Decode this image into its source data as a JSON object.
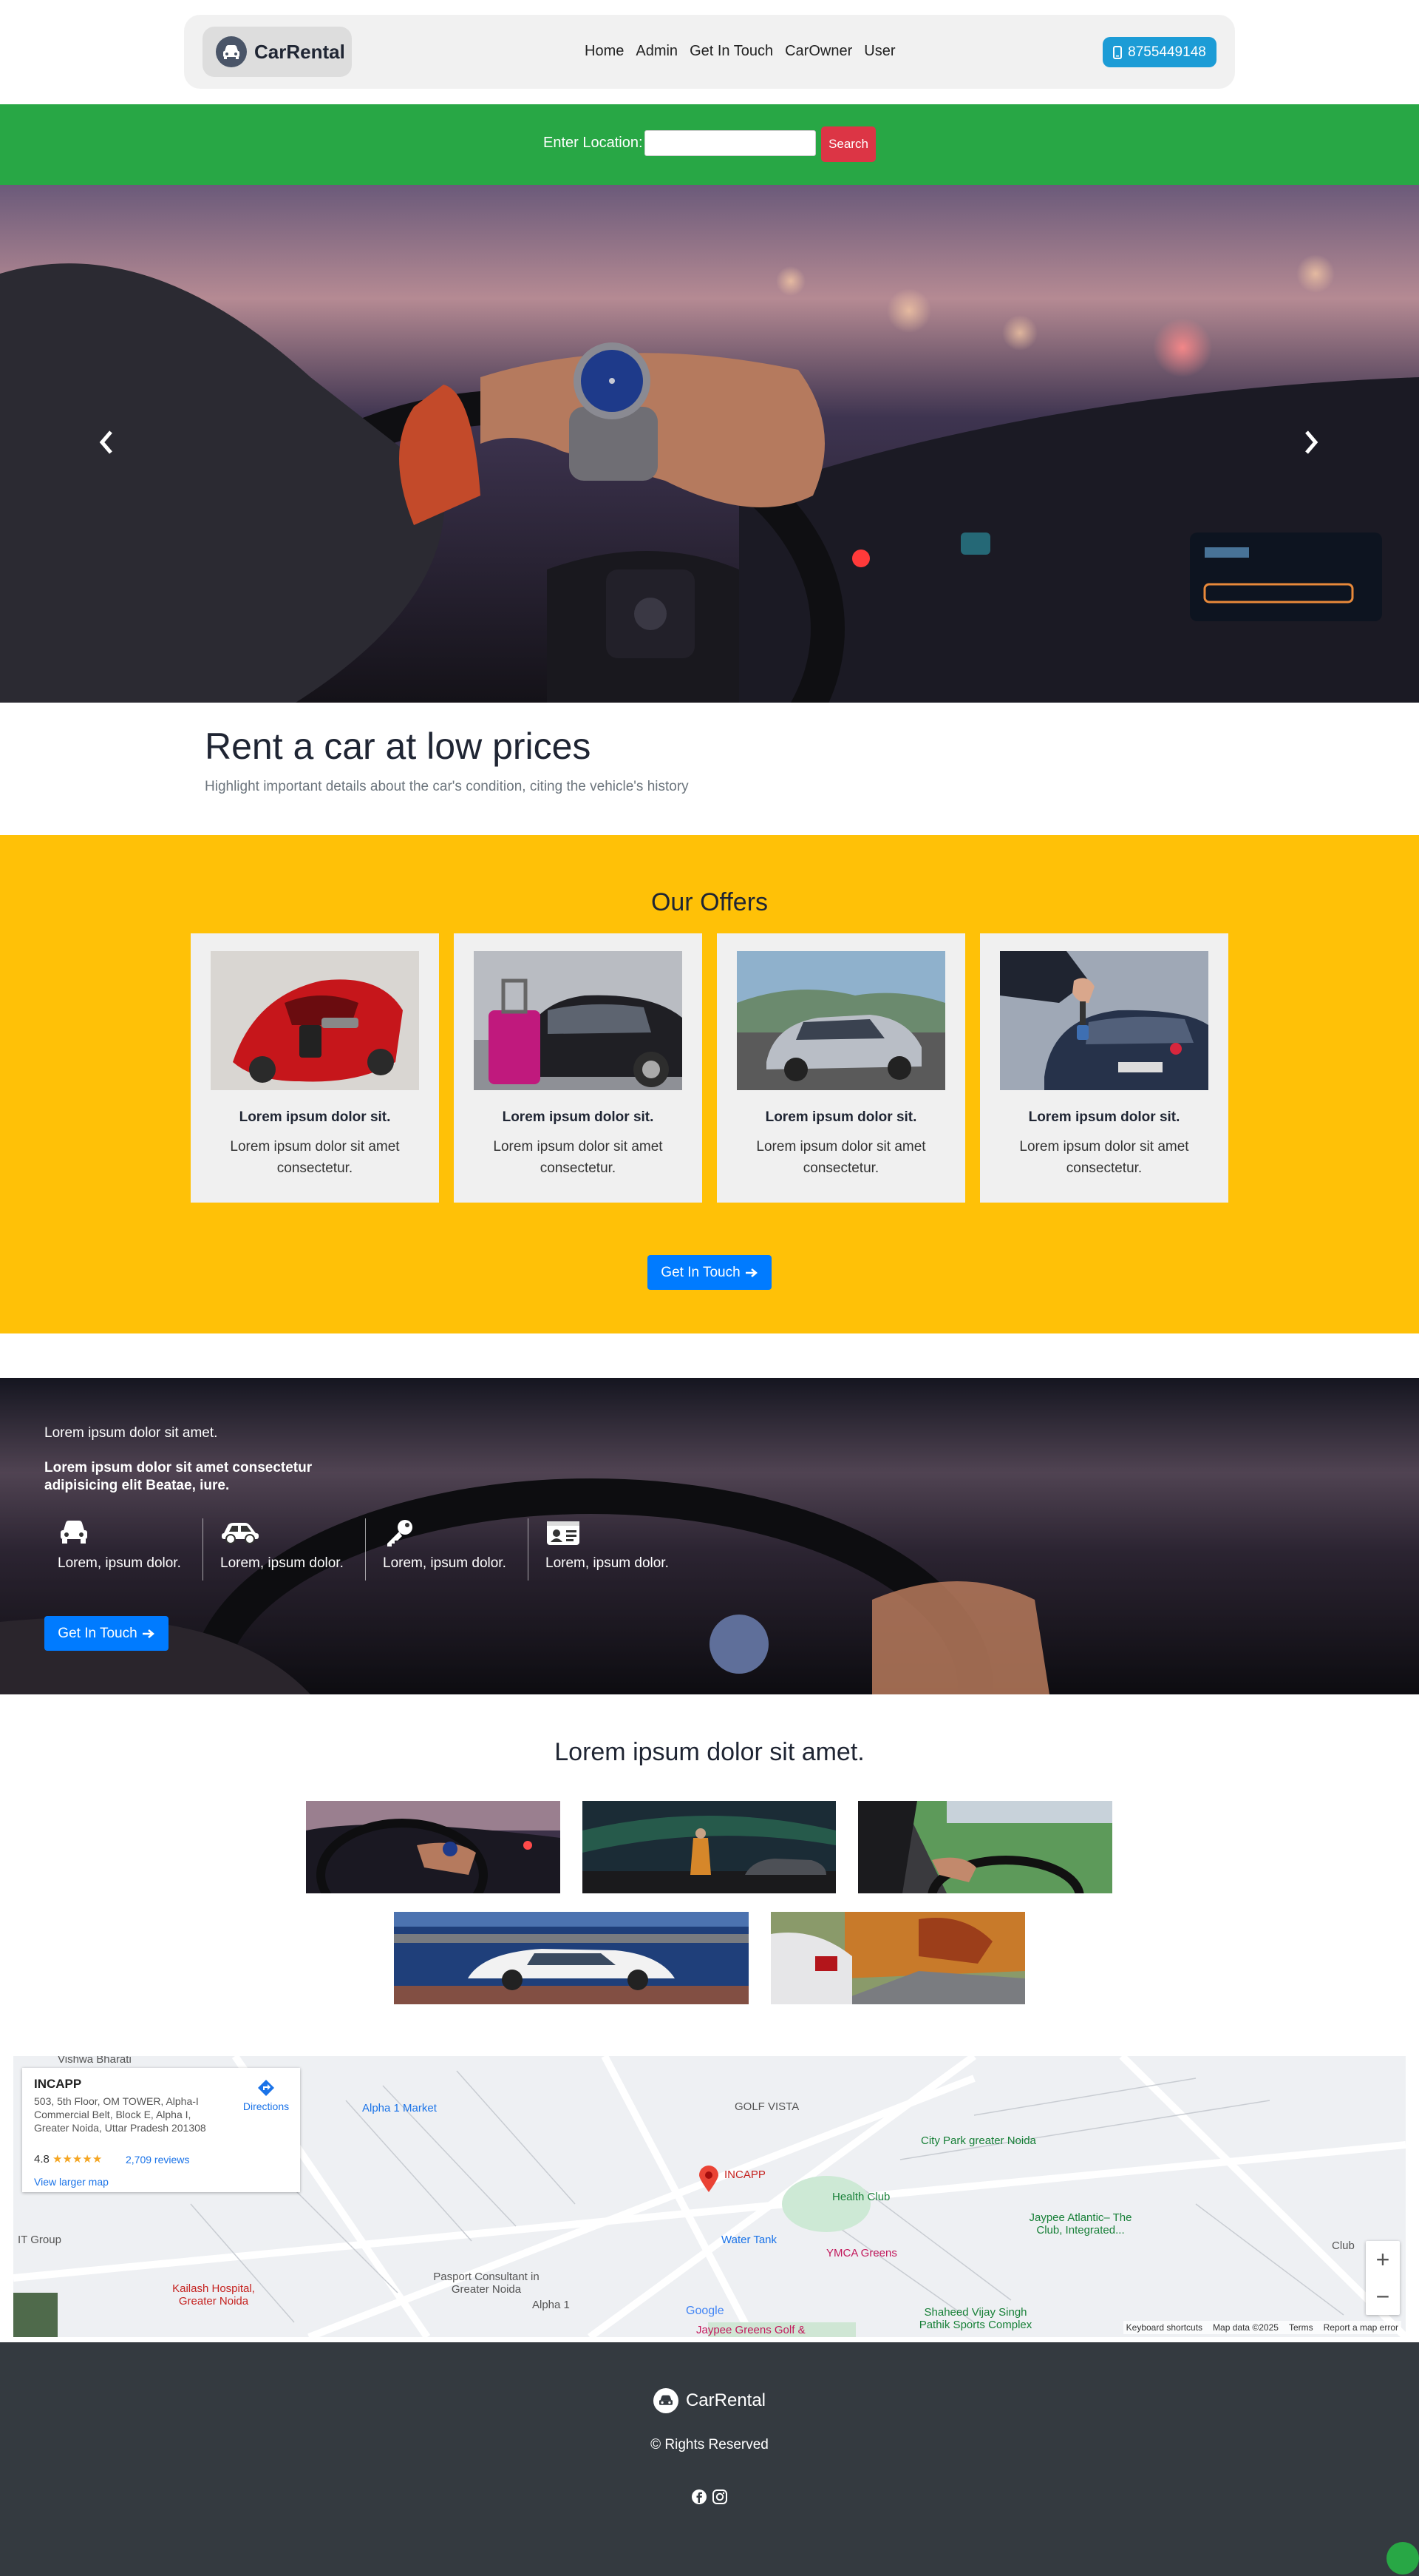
{
  "nav": {
    "brand": "CarRental",
    "links": [
      "Home",
      "Admin",
      "Get In Touch",
      "CarOwner",
      "User"
    ],
    "phone": "8755449148"
  },
  "search": {
    "label": "Enter Location:",
    "value": "",
    "button": "Search"
  },
  "hero": {
    "prev_icon": "chevron-left-icon",
    "next_icon": "chevron-right-icon"
  },
  "intro": {
    "title": "Rent a car at low prices",
    "subtitle": "Highlight important details about the car's condition, citing the vehicle's history"
  },
  "offers": {
    "title": "Our Offers",
    "cards": [
      {
        "title": "Lorem ipsum dolor sit.",
        "text": "Lorem ipsum dolor sit amet consectetur."
      },
      {
        "title": "Lorem ipsum dolor sit.",
        "text": "Lorem ipsum dolor sit amet consectetur."
      },
      {
        "title": "Lorem ipsum dolor sit.",
        "text": "Lorem ipsum dolor sit amet consectetur."
      },
      {
        "title": "Lorem ipsum dolor sit.",
        "text": "Lorem ipsum dolor sit amet consectetur."
      }
    ],
    "button": "Get In Touch"
  },
  "banner": {
    "line1": "Lorem ipsum dolor sit amet.",
    "line2": "Lorem ipsum dolor sit amet consectetur adipisicing elit Beatae, iure.",
    "features": [
      {
        "icon": "car-front-icon",
        "text": "Lorem, ipsum dolor."
      },
      {
        "icon": "car-side-icon",
        "text": "Lorem, ipsum dolor."
      },
      {
        "icon": "key-icon",
        "text": "Lorem, ipsum dolor."
      },
      {
        "icon": "id-card-icon",
        "text": "Lorem, ipsum dolor."
      }
    ],
    "button": "Get In Touch"
  },
  "gallery": {
    "title": "Lorem ipsum dolor sit amet."
  },
  "map": {
    "place": "INCAPP",
    "address": "503, 5th Floor, OM TOWER, Alpha-I Commercial Belt, Block E, Alpha I, Greater Noida, Uttar Pradesh 201308",
    "rating": "4.8",
    "stars": "★★★★★",
    "reviews": "2,709 reviews",
    "larger_map": "View larger map",
    "directions": "Directions",
    "labels": {
      "vishwa": "Vishwa Bharati",
      "alpha_market": "Alpha 1 Market",
      "golf_vista": "GOLF VISTA",
      "city_park": "City Park greater Noida",
      "incapp": "INCAPP",
      "health_club": "Health Club",
      "jaypee_atlantic": "Jaypee Atlantic– The Club, Integrated...",
      "ymca": "YMCA Greens",
      "water_tank": "Water Tank",
      "pasport": "Pasport Consultant in Greater Noida",
      "kailash": "Kailash Hospital, Greater Noida",
      "it_group": "IT Group",
      "shaheed": "Shaheed Vijay Singh Pathik Sports Complex",
      "jaypee_greens": "Jaypee Greens Golf &",
      "alpha1": "Alpha 1",
      "club": "Club"
    },
    "footer": [
      "Keyboard shortcuts",
      "Map data ©2025",
      "Terms",
      "Report a map error"
    ],
    "zoom_in": "+",
    "zoom_out": "−",
    "google": "Google"
  },
  "footer": {
    "brand": "CarRental",
    "rights": "© Rights Reserved"
  }
}
